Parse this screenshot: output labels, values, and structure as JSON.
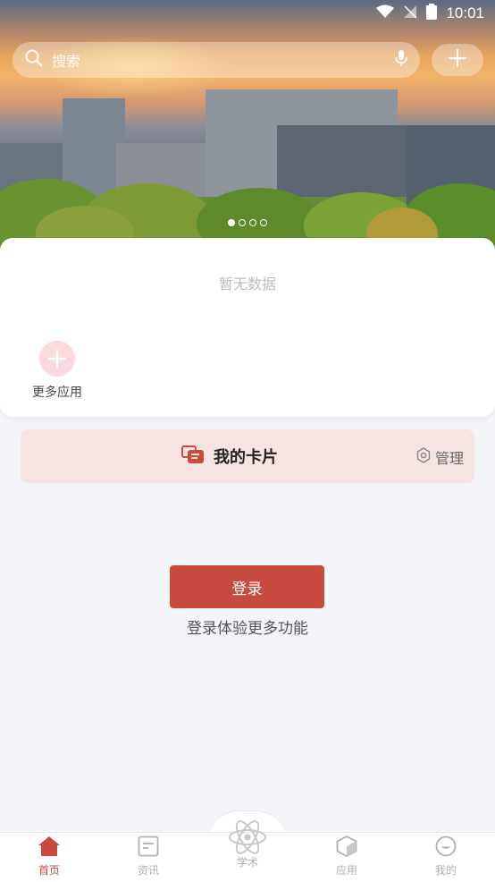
{
  "status_bar": {
    "time": "10:01"
  },
  "search": {
    "placeholder": "搜索"
  },
  "banner": {
    "dots": 4,
    "active_index": 0
  },
  "quick_panel": {
    "empty_text": "暂无数据",
    "more_apps_label": "更多应用"
  },
  "card_bar": {
    "title": "我的卡片",
    "manage_label": "管理"
  },
  "login": {
    "button_label": "登录",
    "hint": "登录体验更多功能"
  },
  "tabs": [
    {
      "label": "首页",
      "icon": "home-icon",
      "active": true
    },
    {
      "label": "资讯",
      "icon": "news-icon",
      "active": false
    },
    {
      "label": "学术",
      "icon": "atom-icon",
      "active": false
    },
    {
      "label": "应用",
      "icon": "app-box-icon",
      "active": false
    },
    {
      "label": "我的",
      "icon": "profile-icon",
      "active": false
    }
  ],
  "colors": {
    "accent": "#c94a3e",
    "card_bg": "#f6e4e3",
    "page_bg": "#f4f5f9"
  }
}
